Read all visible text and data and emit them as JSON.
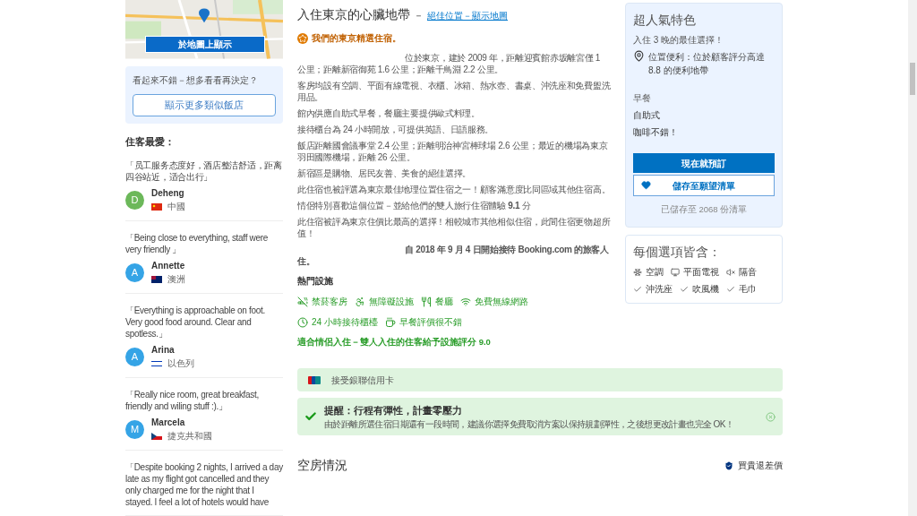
{
  "map": {
    "button": "於地圖上顯示"
  },
  "similar": {
    "prompt": "看起來不錯－想多看看再決定？",
    "button": "顯示更多類似飯店"
  },
  "reviews_title": "住客最愛：",
  "reviews": [
    {
      "quote": "「员工服务态度好，酒店整洁舒适，距离四谷站近，适合出行」",
      "initial": "D",
      "color": "#6cb85a",
      "name": "Deheng",
      "kind": "cn",
      "country": "中國"
    },
    {
      "quote": "「Being close to everything, staff were very friendly 」",
      "initial": "A",
      "color": "#35a4e6",
      "name": "Annette",
      "kind": "au",
      "country": "澳洲"
    },
    {
      "quote": "「Everything is approachable on foot. Very good food around. Clear and spotless.」",
      "initial": "A",
      "color": "#35a4e6",
      "name": "Arina",
      "kind": "il",
      "country": "以色列"
    },
    {
      "quote": "「Really nice room, great breakfast, friendly and wiling stuff :).」",
      "initial": "M",
      "color": "#35a4e6",
      "name": "Marcela",
      "kind": "cz",
      "country": "捷克共和國"
    },
    {
      "quote": "「Despite booking 2 nights, I arrived a day late as my flight got cancelled and they only charged me for the night that I stayed. I feel a lot of hotels would have"
    }
  ],
  "heading": {
    "title": "入住東京的心臟地帶",
    "dash": "－",
    "link": "絕佳位置－顯示地圖"
  },
  "badge": "我們的東京精選住宿。",
  "paragraphs": [
    {
      "kind": "indent",
      "text": "位於東京，建於 2009 年，距離迎賓館赤坂離宮僅 1 公里；距離新宿御苑 1.6 公里；距離千鳥淵 2.2 公里。"
    },
    {
      "kind": "plain",
      "text": "客房均設有空調、平面有線電視、衣櫃、冰箱、熱水壺、書桌、沖洗座和免費盥洗用品。"
    },
    {
      "kind": "plain",
      "text": "館內供應自助式早餐，餐廳主要提供歐式料理。"
    },
    {
      "kind": "plain",
      "text": "接待櫃台為 24 小時開放，可提供英語、日語服務。"
    },
    {
      "kind": "plain",
      "text": "飯店距離國會議事堂 2.4 公里；距離明治神宮棒球場 2.6 公里；最近的機場為東京羽田國際機場，距離 26 公里。"
    },
    {
      "kind": "plain",
      "text": "新宿區是購物、居民友善、美食的絕佳選擇。"
    },
    {
      "kind": "plain",
      "text": "此住宿也被評選為東京最佳地理位置住宿之一！顧客滿意度比同區域其他住宿高。"
    },
    {
      "kind": "plain",
      "text": "情侶特別喜歡這個位置－並給他們的雙人旅行住宿體驗 **9.1** 分"
    },
    {
      "kind": "plain",
      "text": "此住宿被評為東京住價比最高的選擇！相較城市其他相似住宿，此間住宿更物超所值！"
    },
    {
      "kind": "bold",
      "text": "自 2018 年 9 月 4 日開始接待 Booking.com 的旅客人住。"
    }
  ],
  "facilities": {
    "title": "熱門設施",
    "items": [
      {
        "kind": "nosmoking",
        "label": "禁菸客房"
      },
      {
        "kind": "accessible",
        "label": "無障礙設施"
      },
      {
        "kind": "restaurant",
        "label": "餐廳"
      },
      {
        "kind": "wifi",
        "label": "免費無線網路"
      },
      {
        "kind": "frontdesk",
        "label": "24 小時接待櫃檯"
      },
      {
        "kind": "breakfast",
        "label": "早餐評價很不錯"
      }
    ],
    "couples": "適合情侶入住－雙人入住的住客給予設施評分 9.0"
  },
  "unionpay": "接受銀聯信用卡",
  "reminder": {
    "title": "提醒：行程有彈性，計畫零壓力",
    "text": "由於距離所選住宿日期還有一段時間，建議你選擇免費取消方案以保持規劃彈性，之後想更改計畫也完全 OK！"
  },
  "availability": {
    "title": "空房情況",
    "price_match": "買貴退差價"
  },
  "highlights": {
    "title": "超人氣特色",
    "best": "入住 3 晚的最佳選擇！",
    "location": "位置便利：位於顧客評分高達 8.8 的便利地帶",
    "breakfast_label": "早餐",
    "breakfast_type": "自助式",
    "coffee": "咖啡不錯！",
    "book": "現在就預訂",
    "save": "儲存至願望清單",
    "saved": "已儲存至 2068 份清單"
  },
  "included": {
    "title": "每個選項皆含：",
    "items": [
      {
        "kind": "ac",
        "label": "空調"
      },
      {
        "kind": "tv",
        "label": "平面電視"
      },
      {
        "kind": "soundproof",
        "label": "隔音"
      },
      {
        "kind": "check",
        "label": "沖洗座"
      },
      {
        "kind": "check",
        "label": "吹風機"
      },
      {
        "kind": "check",
        "label": "毛巾"
      }
    ]
  }
}
